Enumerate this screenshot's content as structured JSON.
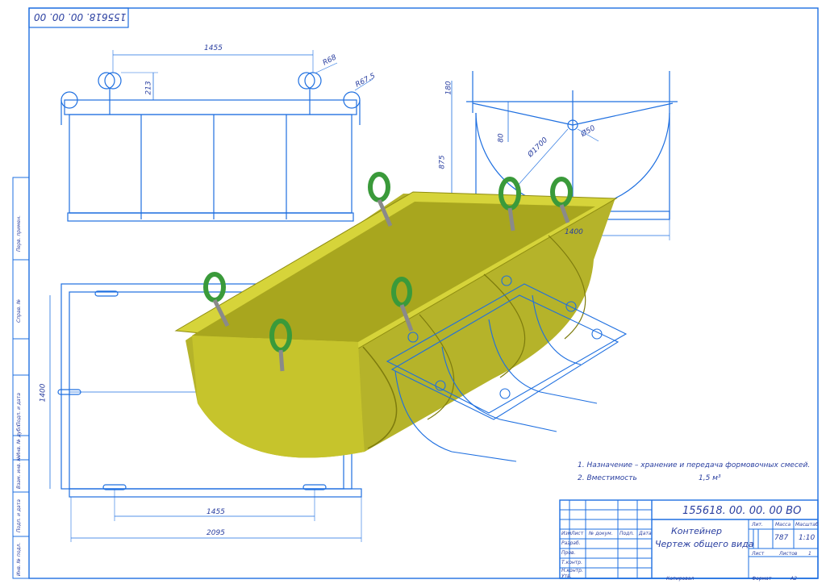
{
  "drawing": {
    "designation": "155618. 00. 00. 00 ВО",
    "designation_rotated": "155618. 00. 00. 00",
    "title_line1": "Контейнер",
    "title_line2": "Чертеж общего вида",
    "mass": "787",
    "scale": "1:10",
    "sheet_label": "Лист",
    "sheets_label": "Листов",
    "sheets_count": "1",
    "lit_label": "Лит.",
    "mass_label": "Масса",
    "scale_label": "Масштаб",
    "copied_label": "Копировал",
    "format_label": "Формат",
    "format_value": "A2"
  },
  "notes": {
    "line1": "1. Назначение – хранение и передача формовочных смесей.",
    "line2_label": "2. Вместимость",
    "line2_value": "1,5 м³"
  },
  "dimensions": {
    "top_span": "1455",
    "r_shackle": "R68",
    "r_shackle2": "R67,5",
    "h_shackle": "213",
    "side_top": "180",
    "side_mid": "80",
    "side_height": "875",
    "phi_arc": "Ø1700",
    "phi_pin": "Ø50",
    "side_width": "1400",
    "plan_width": "1400",
    "plan_span": "1455",
    "plan_length": "2095"
  },
  "title_block_labels": {
    "izm": "Изм",
    "list": "Лист",
    "doc": "№ докум.",
    "sign": "Подп.",
    "date": "Дата",
    "razrab": "Разраб.",
    "prov": "Пров.",
    "tkontr": "Т.контр.",
    "nkontr": "Н.контр.",
    "utv": "Утв."
  },
  "margin_labels": {
    "perv": "Перв. примен.",
    "sprav": "Справ. №",
    "podp_data1": "Подп. и дата",
    "inv_dubl": "Инв. № дубл.",
    "vzam_inv": "Взам. инв. №",
    "podp_data2": "Подп. и дата",
    "inv_podl": "Инв. № подл."
  },
  "colors": {
    "line": "#1e6fe0",
    "text": "#2a3fa0",
    "body": "#c9c72a",
    "body_dark": "#8f8d10",
    "shackle": "#3a9a3a"
  }
}
